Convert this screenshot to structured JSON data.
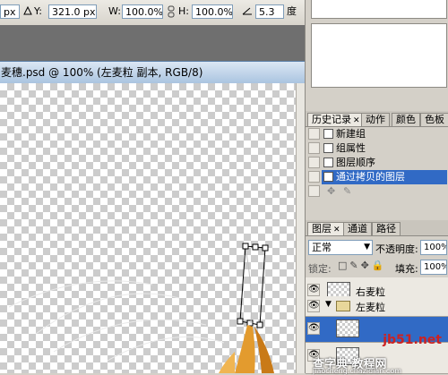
{
  "options_bar": {
    "x_unit_tail": "px",
    "delta_icon": "triangle-icon",
    "y_label": "Y:",
    "y_value": "321.0 px",
    "w_label": "W:",
    "w_value": "100.0%",
    "h_label": "H:",
    "h_value": "100.0%",
    "angle_icon": "angle-icon",
    "angle_value": "5.3",
    "angle_unit": "度"
  },
  "document": {
    "title": "麦穗.psd @ 100% (左麦粒 副本, RGB/8)"
  },
  "history_panel": {
    "tabs": [
      {
        "label": "历史记录",
        "active": true,
        "closable": true
      },
      {
        "label": "动作",
        "active": false
      },
      {
        "label": "颜色",
        "active": false
      },
      {
        "label": "色板",
        "active": false
      }
    ],
    "items": [
      {
        "label": "新建组",
        "selected": false
      },
      {
        "label": "组属性",
        "selected": false
      },
      {
        "label": "图层顺序",
        "selected": false
      },
      {
        "label": "通过拷贝的图层",
        "selected": true
      }
    ]
  },
  "layers_panel": {
    "tabs": [
      {
        "label": "图层",
        "active": true,
        "closable": true
      },
      {
        "label": "通道",
        "active": false
      },
      {
        "label": "路径",
        "active": false
      }
    ],
    "blend_mode": "正常",
    "opacity_label": "不透明度:",
    "opacity_value": "100%",
    "lock_label": "锁定:",
    "fill_label": "填充:",
    "fill_value": "100%",
    "layers": [
      {
        "name": "右麦粒",
        "type": "layer"
      },
      {
        "name": "左麦粒",
        "type": "group"
      }
    ]
  },
  "watermark": {
    "line1": "jb51.net",
    "line2": "查字典 教程网",
    "line3": "jiaocheng.chazidian.com"
  },
  "colors": {
    "selection": "#316ac5",
    "title_bar": "#aac4e0",
    "panel_bg": "#d4d0c8"
  }
}
